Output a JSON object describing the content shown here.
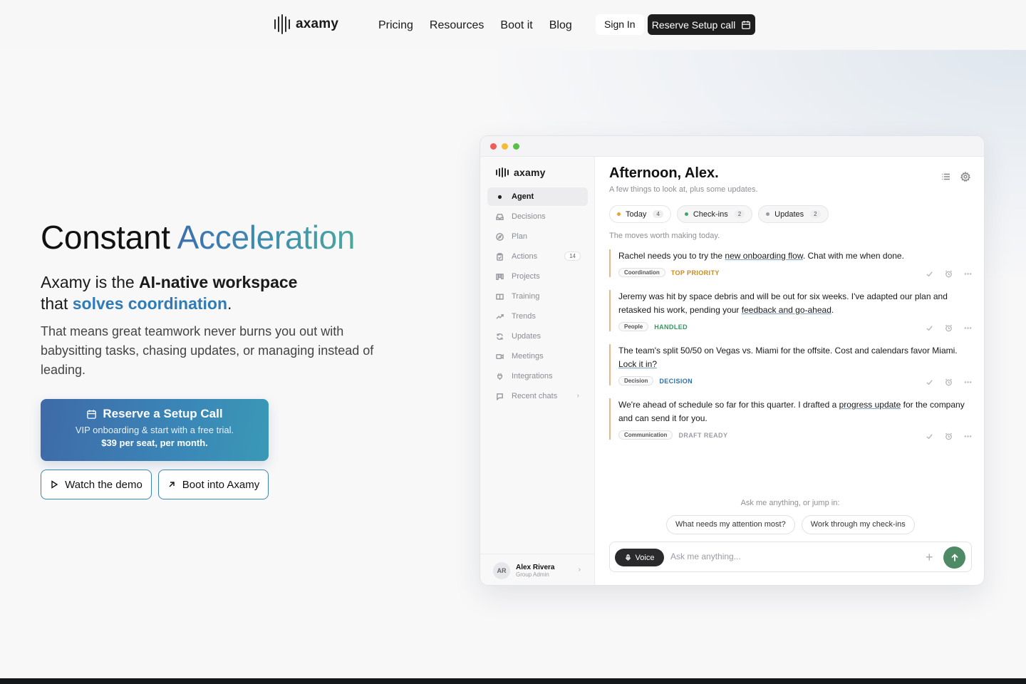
{
  "brand": {
    "name": "axamy"
  },
  "nav": {
    "links": [
      "Pricing",
      "Resources",
      "Boot it",
      "Blog"
    ],
    "signin": "Sign In",
    "reserve": "Reserve Setup call"
  },
  "hero": {
    "title_plain": "Constant ",
    "title_accent": "Acceleration",
    "sub_1": "Axamy is the ",
    "sub_bold": "AI-native workspace",
    "sub_2": "that ",
    "sub_blue": "solves coordination",
    "sub_end": ".",
    "desc": "That means great teamwork never burns you out with babysitting tasks, chasing updates, or managing instead of leading.",
    "cta_title": "Reserve a Setup Call",
    "cta_line": "VIP onboarding & start with a free trial.",
    "cta_price": "$39 per seat, per month.",
    "demo": "Watch the demo",
    "boot": "Boot into Axamy"
  },
  "app": {
    "brand": "axamy",
    "sidebar": [
      {
        "label": "Agent",
        "icon": "agent-icon",
        "active": true
      },
      {
        "label": "Decisions",
        "icon": "inbox-icon"
      },
      {
        "label": "Plan",
        "icon": "compass-icon"
      },
      {
        "label": "Actions",
        "icon": "clipboard-icon",
        "badge": "14"
      },
      {
        "label": "Projects",
        "icon": "kanban-icon"
      },
      {
        "label": "Training",
        "icon": "book-icon"
      },
      {
        "label": "Trends",
        "icon": "trend-icon"
      },
      {
        "label": "Updates",
        "icon": "refresh-icon"
      },
      {
        "label": "Meetings",
        "icon": "video-icon"
      },
      {
        "label": "Integrations",
        "icon": "plug-icon"
      },
      {
        "label": "Recent chats",
        "icon": "chat-icon"
      }
    ],
    "user": {
      "initials": "AR",
      "name": "Alex Rivera",
      "role": "Group Admin"
    },
    "greeting": "Afternoon, Alex.",
    "greeting_sub": "A few things to look at, plus some updates.",
    "pills": [
      {
        "label": "Today",
        "count": "4",
        "color": "#e8a23c"
      },
      {
        "label": "Check-ins",
        "count": "2",
        "color": "#3fa56a"
      },
      {
        "label": "Updates",
        "count": "2",
        "color": "#9a9ca2"
      }
    ],
    "moves": "The moves worth making today.",
    "items": [
      {
        "pre": "Rachel needs you to try the ",
        "link": "new onboarding flow",
        "post": ". Chat with me when done.",
        "tag": "Coordination",
        "status": "TOP PRIORITY",
        "status_color": "#c98a1e"
      },
      {
        "pre": "Jeremy was hit by space debris and will be out for six weeks. I've adapted our plan and retasked his work, pending your ",
        "link": "feedback and go-ahead",
        "post": ".",
        "tag": "People",
        "status": "HANDLED",
        "status_color": "#2f9a5c"
      },
      {
        "pre": "The team's split 50/50 on Vegas vs. Miami for the offsite. Cost and calendars favor Miami. ",
        "link": "Lock it in?",
        "post": "",
        "tag": "Decision",
        "status": "DECISION",
        "status_color": "#2f6fa6"
      },
      {
        "pre": "We're ahead of schedule so far for this quarter. I drafted a ",
        "link": "progress update",
        "post": " for the company and can send it for you.",
        "tag": "Communication",
        "status": "DRAFT READY",
        "status_color": "#9a9ca2"
      }
    ],
    "ask": "Ask me anything, or jump in:",
    "suggestions": [
      "What needs my attention most?",
      "Work through my check-ins"
    ],
    "voice": "Voice",
    "input_placeholder": "Ask me anything..."
  }
}
